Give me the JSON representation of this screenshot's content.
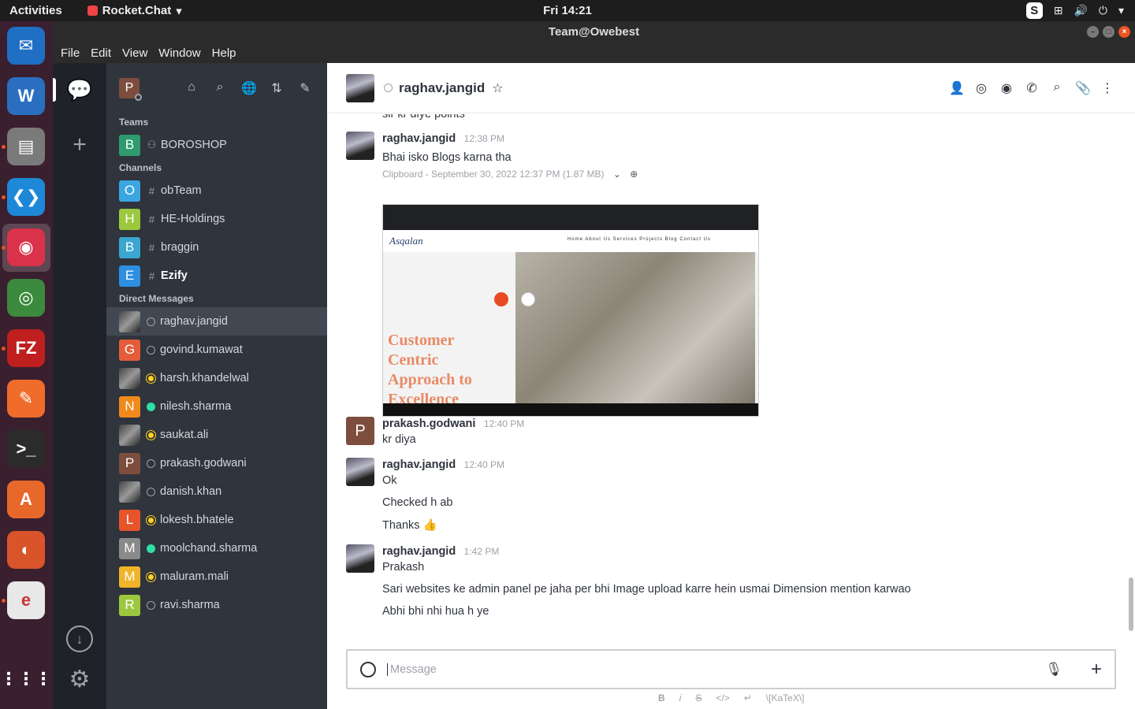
{
  "topbar": {
    "activities": "Activities",
    "app_name": "Rocket.Chat",
    "clock": "Fri 14:21"
  },
  "window": {
    "title": "Team@Owebest"
  },
  "menu": [
    "File",
    "Edit",
    "View",
    "Window",
    "Help"
  ],
  "dock": [
    {
      "name": "thunderbird-icon",
      "color": "#1f6fc4",
      "glyph": "✉"
    },
    {
      "name": "libreoffice-writer-icon",
      "color": "#2a6fbf",
      "glyph": "W"
    },
    {
      "name": "files-icon",
      "color": "#7a7a7a",
      "glyph": "▤"
    },
    {
      "name": "vscode-icon",
      "color": "#1e88d8",
      "glyph": "❮❯"
    },
    {
      "name": "rocketchat-icon",
      "color": "#d9324a",
      "glyph": "◉"
    },
    {
      "name": "chrome-icon",
      "color": "#3b8a3e",
      "glyph": "◎"
    },
    {
      "name": "filezilla-icon",
      "color": "#bf1f1f",
      "glyph": "FZ"
    },
    {
      "name": "postman-icon",
      "color": "#ef6c2b",
      "glyph": "✎"
    },
    {
      "name": "terminal-icon",
      "color": "#2b2b2b",
      "glyph": ">_"
    },
    {
      "name": "software-center-icon",
      "color": "#e8682c",
      "glyph": "A"
    },
    {
      "name": "firefox-icon",
      "color": "#d9542a",
      "glyph": "◐"
    },
    {
      "name": "text-editor-icon",
      "color": "#e8e8e8",
      "glyph": "e"
    },
    {
      "name": "show-apps-icon",
      "color": "transparent",
      "glyph": "⋮⋮⋮"
    }
  ],
  "sidebar": {
    "user_initial": "P",
    "sections": {
      "teams": "Teams",
      "channels": "Channels",
      "dms": "Direct Messages"
    },
    "teams": [
      {
        "initial": "B",
        "name": "BOROSHOP",
        "color": "#2e9b6e"
      }
    ],
    "channels": [
      {
        "initial": "O",
        "name": "obTeam",
        "color": "#3ba6e0",
        "bold": false
      },
      {
        "initial": "H",
        "name": "HE-Holdings",
        "color": "#9bc83e",
        "bold": false
      },
      {
        "initial": "B",
        "name": "braggin",
        "color": "#3ba6d0",
        "bold": false
      },
      {
        "initial": "E",
        "name": "Ezify",
        "color": "#2d8fe0",
        "bold": true
      }
    ],
    "dms": [
      {
        "initial": "",
        "name": "raghav.jangid",
        "status": "offline",
        "color": "img",
        "active": true
      },
      {
        "initial": "G",
        "name": "govind.kumawat",
        "status": "offline",
        "color": "#e45c3a"
      },
      {
        "initial": "",
        "name": "harsh.khandelwal",
        "status": "away",
        "color": "img"
      },
      {
        "initial": "N",
        "name": "nilesh.sharma",
        "status": "online",
        "color": "#f08a1c"
      },
      {
        "initial": "",
        "name": "saukat.ali",
        "status": "away",
        "color": "img"
      },
      {
        "initial": "P",
        "name": "prakash.godwani",
        "status": "offline",
        "color": "#7d4e3e"
      },
      {
        "initial": "",
        "name": "danish.khan",
        "status": "offline",
        "color": "img"
      },
      {
        "initial": "L",
        "name": "lokesh.bhatele",
        "status": "away",
        "color": "#e8542a"
      },
      {
        "initial": "M",
        "name": "moolchand.sharma",
        "status": "online",
        "color": "#8a8a8a"
      },
      {
        "initial": "M",
        "name": "maluram.mali",
        "status": "away",
        "color": "#f0b42a"
      },
      {
        "initial": "R",
        "name": "ravi.sharma",
        "status": "offline",
        "color": "#9bc83e"
      }
    ]
  },
  "room": {
    "name": "raghav.jangid"
  },
  "messages": {
    "partial_prev": "sir kr diye points",
    "m1": {
      "user": "raghav.jangid",
      "time": "12:38 PM",
      "text": "Bhai isko Blogs karna tha",
      "attachment": "Clipboard - September 30, 2022 12:37 PM (1.87 MB)",
      "shot": {
        "brand": "Asqalan",
        "links": "Home About Us Services Projects Blog Contact Us",
        "hero": [
          "Customer",
          "Centric",
          "Approach to",
          "Excellence"
        ]
      }
    },
    "m2": {
      "user": "prakash.godwani",
      "time": "12:40 PM",
      "avatar": "P",
      "text": "kr diya"
    },
    "m3": {
      "user": "raghav.jangid",
      "time": "12:40 PM",
      "lines": [
        "Ok",
        "Checked h ab",
        "Thanks 👍"
      ]
    },
    "m4": {
      "user": "raghav.jangid",
      "time": "1:42 PM",
      "lines": [
        "Prakash",
        "Sari websites ke admin panel pe jaha per bhi Image upload karre hein usmai Dimension mention karwao",
        "Abhi bhi nhi hua h ye"
      ]
    }
  },
  "composer": {
    "placeholder": "Message",
    "format": [
      "B",
      "i",
      "S",
      "</>",
      "↵",
      "\\[KaTeX\\]"
    ]
  }
}
